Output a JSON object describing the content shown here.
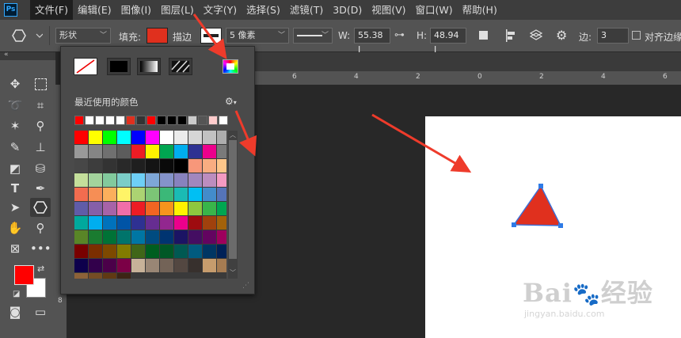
{
  "app": {
    "logo": "Ps"
  },
  "menu": [
    "文件(F)",
    "编辑(E)",
    "图像(I)",
    "图层(L)",
    "文字(Y)",
    "选择(S)",
    "滤镜(T)",
    "3D(D)",
    "视图(V)",
    "窗口(W)",
    "帮助(H)"
  ],
  "options": {
    "tool_mode": "形状",
    "fill_label": "填充:",
    "fill_color": "#e0301e",
    "stroke_label": "描边",
    "stroke_width": "5 像素",
    "w_label": "W:",
    "w_value": "55.38 I",
    "h_label": "H:",
    "h_value": "48.94 I",
    "sides_label": "边:",
    "sides_value": "3",
    "align_edges_label": "对齐边缘"
  },
  "popup": {
    "recent_label": "最近使用的颜色",
    "recent_colors": [
      "#ff0000",
      "#ffffff",
      "#ffffff",
      "#ffffff",
      "#ffffff",
      "#e0301e",
      "#333333",
      "#ff0000",
      "#000000",
      "#000000",
      "#000000",
      "#cccccc",
      "#555555",
      "#ffcccc",
      "#ffffff"
    ],
    "swatches": [
      "#ff0000",
      "#ffff00",
      "#00ff00",
      "#00ffff",
      "#0000ff",
      "#ff00ff",
      "#ffffff",
      "#ebebeb",
      "#d6d6d6",
      "#c2c2c2",
      "#adadad",
      "#999999",
      "#858585",
      "#707070",
      "#5c5c5c",
      "#ed1c24",
      "#fff200",
      "#00a651",
      "#00aeef",
      "#2e3192",
      "#ec008c",
      "#7a7a7a",
      "#474747",
      "#3d3d3d",
      "#333333",
      "#292929",
      "#1f1f1f",
      "#141414",
      "#0a0a0a",
      "#000000",
      "#f7977a",
      "#f9ad81",
      "#fdc68a",
      "#c4df9b",
      "#a3d39c",
      "#82ca9d",
      "#7bcdc8",
      "#6ecff6",
      "#7ea7d8",
      "#8493ca",
      "#8882be",
      "#a187be",
      "#bc8dbf",
      "#f49ac2",
      "#f26c4f",
      "#f68e55",
      "#fbaf5c",
      "#fff467",
      "#acd372",
      "#7cc576",
      "#3bb878",
      "#1abbb4",
      "#00bff3",
      "#438ccb",
      "#5574b9",
      "#605ca8",
      "#855fa8",
      "#a763a8",
      "#f06ea9",
      "#ed1c24",
      "#f26522",
      "#f7941d",
      "#fff200",
      "#8dc73f",
      "#39b54a",
      "#00a651",
      "#00a99d",
      "#00aeef",
      "#0072bc",
      "#0054a6",
      "#2e3192",
      "#662d91",
      "#92278f",
      "#ec008c",
      "#9e0b0f",
      "#a0410d",
      "#a3620a",
      "#598527",
      "#1a7b30",
      "#007236",
      "#00746b",
      "#0076a3",
      "#004b80",
      "#003471",
      "#1b1464",
      "#440e62",
      "#630460",
      "#9e005d",
      "#790000",
      "#7b2e00",
      "#7d4900",
      "#827b00",
      "#406618",
      "#005e20",
      "#005826",
      "#005952",
      "#005b7f",
      "#003663",
      "#002157",
      "#0d004c",
      "#32004b",
      "#4b0049",
      "#7b0046",
      "#c7b299",
      "#998675",
      "#736357",
      "#534741",
      "#37302d",
      "#c69c6d",
      "#a67c52",
      "#8c6239",
      "#754c24",
      "#603913",
      "#3c2415"
    ]
  }
}
